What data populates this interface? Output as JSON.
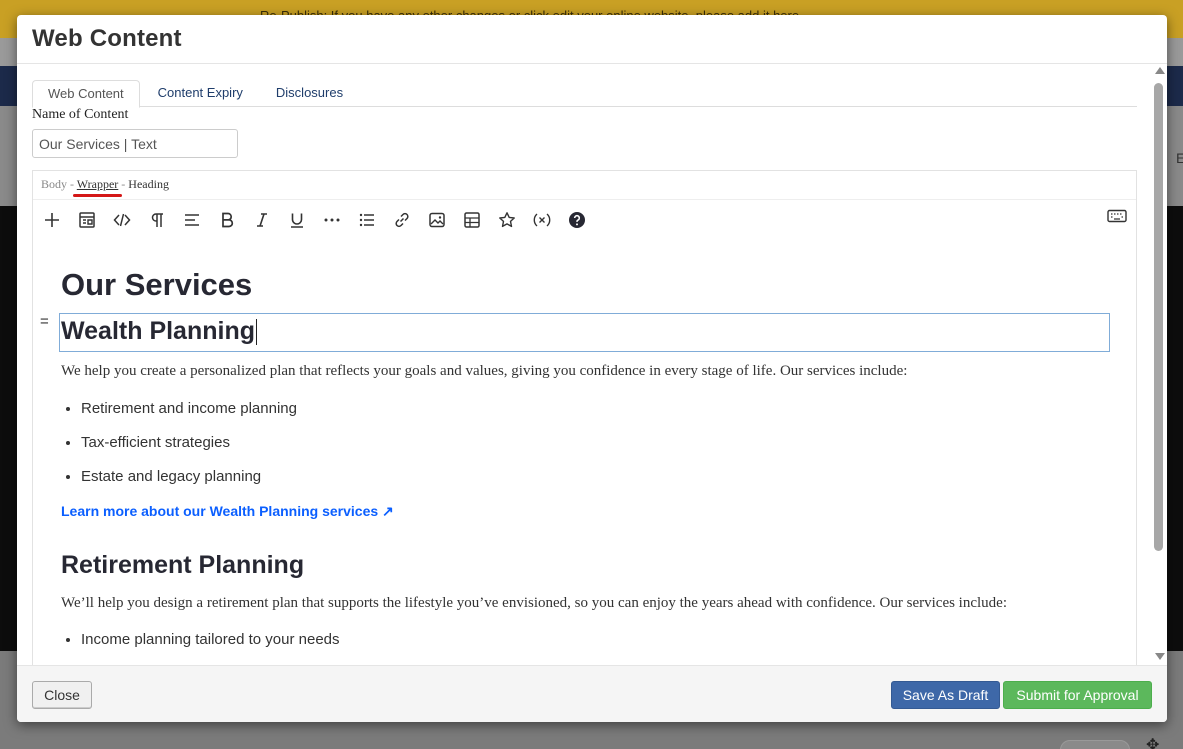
{
  "background": {
    "banner_text": "Re-Publish: If you have any other changes or click edit your online website, please add it here",
    "side_letter": "E"
  },
  "modal": {
    "title": "Web Content",
    "tabs": [
      {
        "label": "Web Content",
        "active": true
      },
      {
        "label": "Content Expiry",
        "active": false
      },
      {
        "label": "Disclosures",
        "active": false
      }
    ],
    "name_label": "Name of Content",
    "name_value": "Our Services | Text",
    "breadcrumb": {
      "items": [
        "Body",
        "Wrapper",
        "Heading"
      ],
      "separator": " - "
    },
    "toolbar": {
      "icons": [
        "plus-icon",
        "fragment-icon",
        "source-code-icon",
        "paragraph-icon",
        "align-icon",
        "bold-icon",
        "italic-icon",
        "underline-icon",
        "more-icon",
        "list-icon",
        "link-icon",
        "image-icon",
        "table-icon",
        "star-icon",
        "variable-icon",
        "help-icon",
        "keyboard-icon"
      ]
    },
    "content": {
      "heading": "Our Services",
      "section1_title": "Wealth Planning",
      "section1_intro": "We help you create a personalized plan that reflects your goals and values, giving you confidence in every stage of life. Our services include:",
      "section1_items": [
        "Retirement and income planning",
        "Tax-efficient strategies",
        "Estate and legacy planning"
      ],
      "section1_link": "Learn more about our Wealth Planning services ↗",
      "section2_title": "Retirement Planning",
      "section2_intro": "We’ll help you design a retirement plan that supports the lifestyle you’ve envisioned, so you can enjoy the years ahead with confidence. Our services include:",
      "section2_items": [
        "Income planning tailored to your needs"
      ]
    },
    "footer": {
      "close_label": "Close",
      "draft_label": "Save As Draft",
      "submit_label": "Submit for Approval"
    }
  },
  "colors": {
    "banner": "#c9a024",
    "link": "#0b5fff",
    "draft_button": "#3e68a8",
    "submit_button": "#5cb85c",
    "breadcrumb_underline": "#d41717"
  }
}
